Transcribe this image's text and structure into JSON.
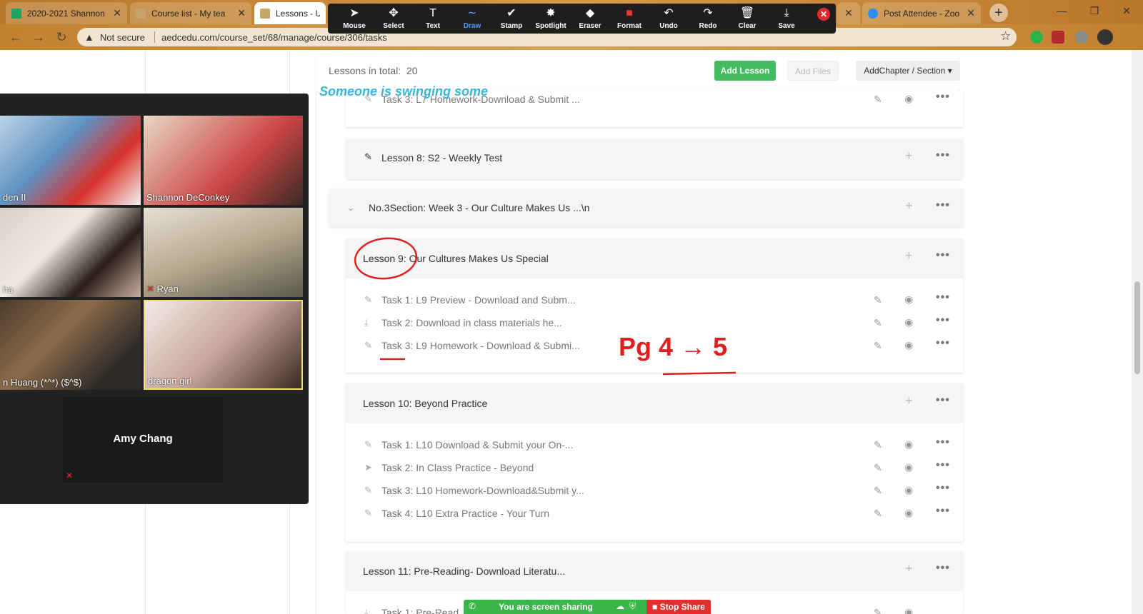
{
  "tabs": [
    {
      "title": "2020-2021 Shannon",
      "fav": "#1ea362"
    },
    {
      "title": "Course list - My tea",
      "fav": "#c8a56a"
    },
    {
      "title": "Lessons - Unit",
      "fav": "#c8a56a"
    },
    {
      "title": "Post Attendee - Zoo",
      "fav": "#2d8cff"
    }
  ],
  "address": {
    "warning": "Not secure",
    "url": "aedcedu.com/course_set/68/manage/course/306/tasks"
  },
  "zoom_toolbar": [
    {
      "label": "Mouse",
      "icon": "➤"
    },
    {
      "label": "Select",
      "icon": "✥"
    },
    {
      "label": "Text",
      "icon": "T"
    },
    {
      "label": "Draw",
      "icon": "∼"
    },
    {
      "label": "Stamp",
      "icon": "✔"
    },
    {
      "label": "Spotlight",
      "icon": "✸"
    },
    {
      "label": "Eraser",
      "icon": "◆"
    },
    {
      "label": "Format",
      "icon": "■"
    },
    {
      "label": "Undo",
      "icon": "↶"
    },
    {
      "label": "Redo",
      "icon": "↷"
    },
    {
      "label": "Clear",
      "icon": "🗑"
    },
    {
      "label": "Save",
      "icon": "⤓"
    }
  ],
  "topbar": {
    "lessons_total_label": "Lessons in total:",
    "lessons_total": "20",
    "add_lesson": "Add Lesson",
    "add_files": "Add Files",
    "add_chapter": "AddChapter / Section ▾"
  },
  "rows": {
    "prev_task": "Task 3:   L7 Homework-Download & Submit ...",
    "lesson8": "Lesson 8:   S2 - Weekly Test",
    "section3": "No.3Section:  Week 3 - Our Culture Makes Us ...\\n",
    "lesson9": "Lesson 9:   Our Cultures Makes Us Special",
    "l9_tasks": [
      "Task 1:   L9 Preview - Download and Subm...",
      "Task 2:   Download in class materials he...",
      "Task 3:   L9 Homework - Download & Submi..."
    ],
    "lesson10": "Lesson 10:   Beyond Practice",
    "l10_tasks": [
      "Task 1:   L10 Download & Submit your On-...",
      "Task 2:   In Class Practice - Beyond",
      "Task 3:   L10 Homework-Download&Submit y...",
      "Task 4:   L10 Extra Practice - Your Turn"
    ],
    "lesson11": "Lesson 11:   Pre-Reading- Download Literatu...",
    "l11_task": "Task 1:   Pre-Read"
  },
  "gallery": {
    "participants": [
      "den II",
      "Shannon DeConkey",
      "ha",
      "Ryan",
      "n Huang (*^*) ($^$)",
      "dragon girl"
    ],
    "speaker": "Amy Chang"
  },
  "annotations": {
    "text": "Someone is swinging some",
    "handwriting": "Pg 4 → 5"
  },
  "share": {
    "status": "You are screen sharing",
    "stop": "Stop Share"
  }
}
